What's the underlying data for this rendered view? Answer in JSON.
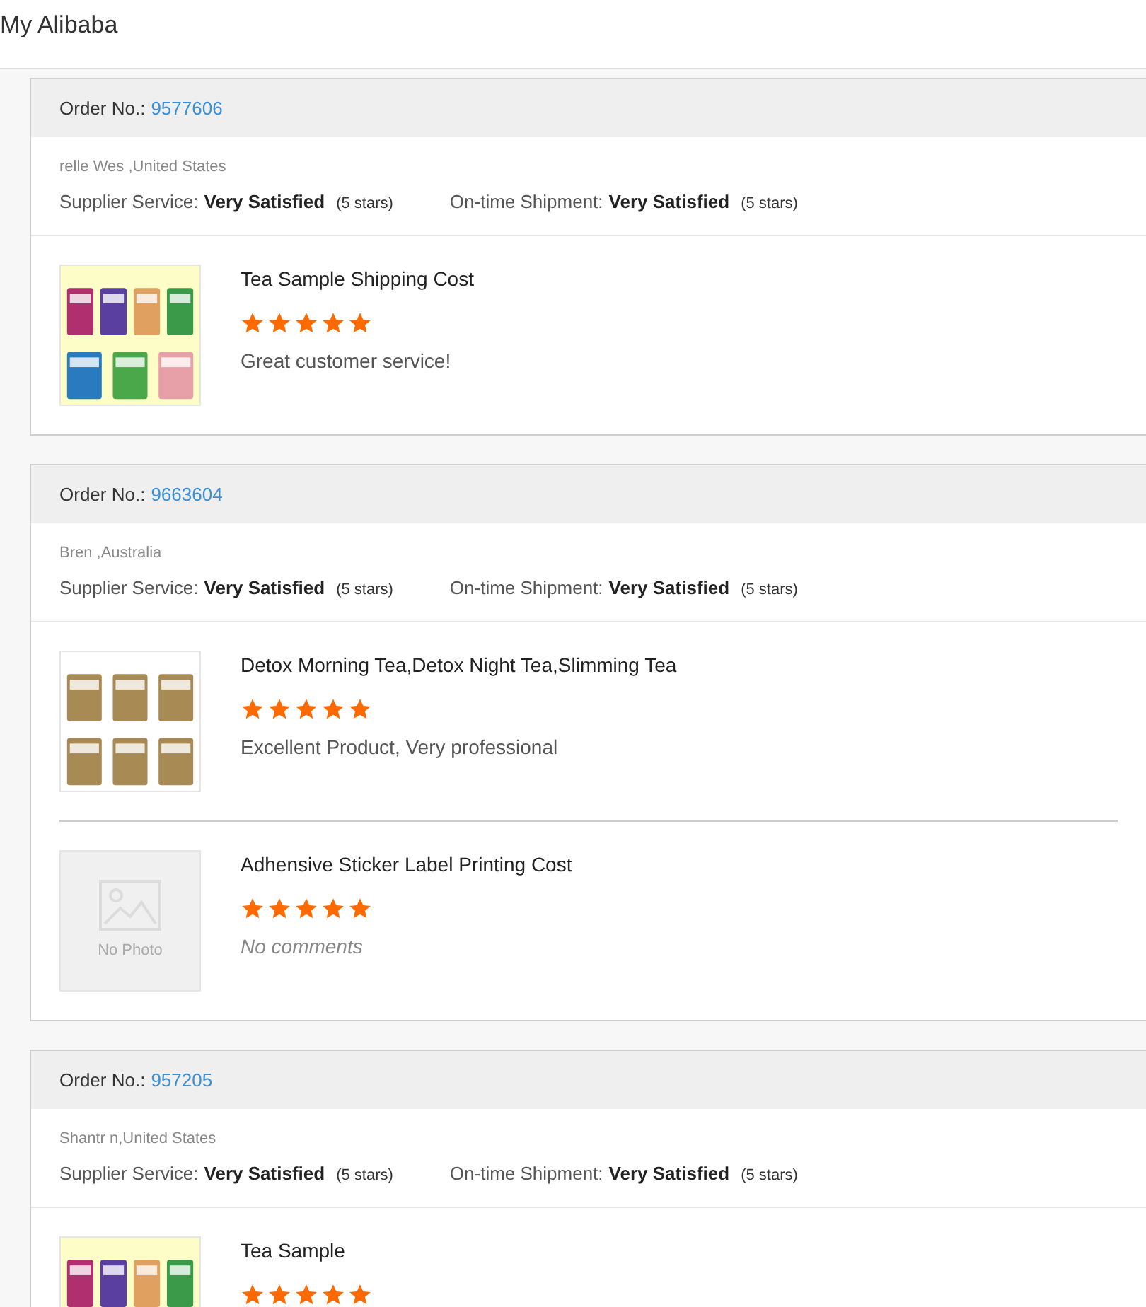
{
  "page_title": "My Alibaba",
  "orders": [
    {
      "order_label": "Order No.:",
      "order_no": "9577606",
      "location": "relle Wes ,United States",
      "supplier_label": "Supplier Service:",
      "supplier_value": "Very Satisfied",
      "supplier_stars": "(5 stars)",
      "shipment_label": "On-time Shipment:",
      "shipment_value": "Very Satisfied",
      "shipment_stars": "(5 stars)",
      "products": [
        {
          "title": "Tea Sample Shipping Cost",
          "stars": 5,
          "kind": "comment",
          "comment": "Great customer service!",
          "image": {
            "kind": "bright_pouches"
          }
        }
      ]
    },
    {
      "order_label": "Order No.:",
      "order_no": "9663604",
      "location": "Bren ,Australia",
      "supplier_label": "Supplier Service:",
      "supplier_value": "Very Satisfied",
      "supplier_stars": "(5 stars)",
      "shipment_label": "On-time Shipment:",
      "shipment_value": "Very Satisfied",
      "shipment_stars": "(5 stars)",
      "products": [
        {
          "title": "Detox Morning Tea,Detox Night Tea,Slimming Tea",
          "stars": 5,
          "kind": "comment",
          "comment": "Excellent Product, Very professional",
          "image": {
            "kind": "kraft_pouches"
          }
        },
        {
          "title": "Adhensive Sticker Label Printing Cost",
          "stars": 5,
          "kind": "no_comment",
          "comment": "No comments",
          "image": {
            "kind": "no_photo",
            "text": "No Photo"
          }
        }
      ]
    },
    {
      "order_label": "Order No.:",
      "order_no": "957205",
      "location": "Shantr n,United States",
      "supplier_label": "Supplier Service:",
      "supplier_value": "Very Satisfied",
      "supplier_stars": "(5 stars)",
      "shipment_label": "On-time Shipment:",
      "shipment_value": "Very Satisfied",
      "shipment_stars": "(5 stars)",
      "products": [
        {
          "title": "Tea Sample",
          "stars": 5,
          "kind": "title_only",
          "image": {
            "kind": "bright_pouches"
          }
        }
      ]
    }
  ]
}
